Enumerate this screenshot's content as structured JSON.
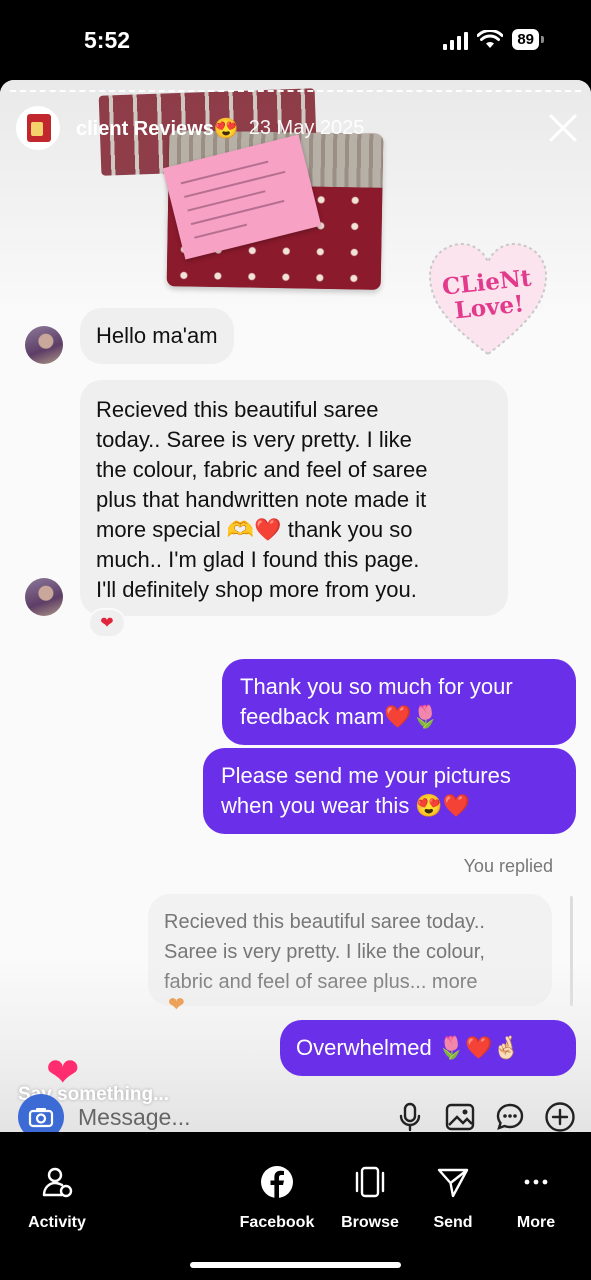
{
  "status_bar": {
    "time": "5:52",
    "battery": "89"
  },
  "story": {
    "user_name": "client Reviews😍",
    "date": "23 May 2025",
    "sticker_text": [
      "CLieNt",
      "Love!"
    ]
  },
  "chat": {
    "incoming": [
      "Hello ma'am",
      [
        "Recieved this beautiful saree",
        "today.. Saree is very pretty. I like",
        "the colour, fabric and feel of saree",
        "plus that handwritten note made it",
        "more special 🫶❤️ thank you so",
        "much.. I'm glad I found this page.",
        "I'll definitely shop more from you."
      ]
    ],
    "reaction": "❤",
    "outgoing": [
      [
        "Thank you so much for your",
        "feedback mam❤️🌷"
      ],
      [
        "Please send me your pictures",
        "when you wear this 😍❤️"
      ]
    ],
    "you_replied": "You replied",
    "reply_quote": [
      "Recieved this beautiful saree today..",
      "Saree is very pretty. I like the colour,",
      "fabric and feel of saree plus... more"
    ],
    "overwhelmed": "Overwhelmed 🌷❤️🤞🏻"
  },
  "input": {
    "say_something": "Say something...",
    "placeholder": "Message..."
  },
  "nav": {
    "activity": "Activity",
    "facebook": "Facebook",
    "browse": "Browse",
    "send": "Send",
    "more": "More"
  }
}
